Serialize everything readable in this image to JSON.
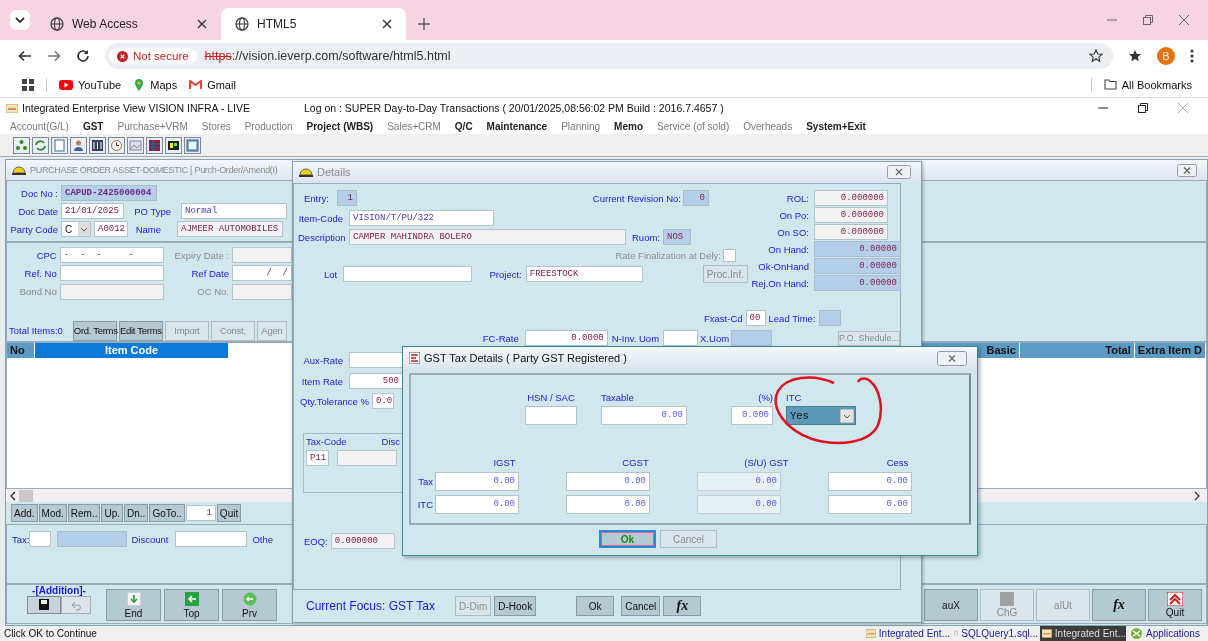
{
  "browser": {
    "tabs": [
      {
        "label": "Web Access",
        "selected": false
      },
      {
        "label": "HTML5",
        "selected": true
      }
    ],
    "security": "Not secure",
    "url_scheme": "https",
    "url_rest": "://vision.ieverp.com/software/html5.html",
    "profile": "B",
    "bookmarks": [
      "YouTube",
      "Maps",
      "Gmail"
    ],
    "all_bookmarks": "All Bookmarks"
  },
  "app": {
    "title": "Integrated Enterprise View  VISION INFRA - LIVE",
    "logon": "Log on : SUPER  Day-to-Day Transactions ( 20/01/2025,08:56:02 PM Build : 2016.7.4657 )",
    "menu": [
      {
        "label": "Account(G/L)",
        "disabled": true
      },
      {
        "label": "GST",
        "disabled": false
      },
      {
        "label": "Purchase+VRM",
        "disabled": true
      },
      {
        "label": "Stores",
        "disabled": true
      },
      {
        "label": "Production",
        "disabled": true
      },
      {
        "label": "Project (WBS)",
        "disabled": false
      },
      {
        "label": "Sales+CRM",
        "disabled": true
      },
      {
        "label": "Q/C",
        "disabled": false
      },
      {
        "label": "Maintenance",
        "disabled": false
      },
      {
        "label": "Planning",
        "disabled": true
      },
      {
        "label": "Memo",
        "disabled": false
      },
      {
        "label": "Service (of sold)",
        "disabled": true
      },
      {
        "label": "Overheads",
        "disabled": true
      },
      {
        "label": "System+Exit",
        "disabled": false
      }
    ]
  },
  "po_window": {
    "title": "PURCHASE ORDER ASSET-DOMESTIC  [  Purch-Order/Amend(I)",
    "doc_no": {
      "label": "Doc No :",
      "value": "CAPUD-2425000004"
    },
    "doc_date": {
      "label": "Doc Date",
      "value": "21/01/2025"
    },
    "po_type": {
      "label": "PO Type",
      "value": "Normal"
    },
    "party_code": {
      "label": "Party Code",
      "type": "C",
      "value": "A0012"
    },
    "name": {
      "label": "Name",
      "value": "AJMEER AUTOMOBILES"
    },
    "field_rows": [
      [
        {
          "label": "CPC",
          "value": "-  -  -     -",
          "disabled": false
        },
        {
          "label": "Expiry Date :",
          "disabled": true
        }
      ],
      [
        {
          "label": "Ref. No",
          "disabled": false
        },
        {
          "label": "Ref Date",
          "value": " /  /",
          "disabled": false
        }
      ],
      [
        {
          "label": "Bond No",
          "disabled": true
        },
        {
          "label": "OC No.",
          "disabled": true
        }
      ]
    ],
    "total_items": "Total Items:0",
    "terms_buttons": [
      {
        "label": "Ord. Terms",
        "disabled": false
      },
      {
        "label": "Edit Terms",
        "disabled": false
      },
      {
        "label": "Import",
        "disabled": true
      },
      {
        "label": "Const.",
        "disabled": true
      },
      {
        "label": "Agen",
        "disabled": true
      }
    ],
    "columns_left": [
      {
        "label": "No",
        "selected": false
      },
      {
        "label": "Item Code",
        "selected": true
      }
    ],
    "columns_right": [
      "Basic",
      "Total",
      "Extra Item D"
    ],
    "row_buttons": [
      "Add.",
      "Mod.",
      "Rem..",
      "Up.",
      "Dn..",
      "GoTo.."
    ],
    "goto_value": "1",
    "quit": "Quit",
    "tax_label": "Tax:",
    "discount_label": "Discount",
    "other_label": "Othe",
    "mode": "-[Addition]-",
    "nav_left": [
      {
        "label": "End",
        "kind": "down"
      },
      {
        "label": "Top",
        "kind": "left"
      },
      {
        "label": "Prv",
        "kind": "circle"
      }
    ],
    "nav_right": [
      {
        "label": "auX",
        "kind": "text",
        "disabled": false
      },
      {
        "label": "ChG",
        "kind": "square",
        "disabled": true
      },
      {
        "label": "alUt",
        "kind": "text",
        "disabled": true
      },
      {
        "label": "fx",
        "kind": "formula",
        "disabled": false
      },
      {
        "label": "Quit",
        "kind": "quit",
        "disabled": false
      }
    ]
  },
  "details": {
    "title": "Details",
    "entry": {
      "label": "Entry:",
      "value": "1"
    },
    "revision": {
      "label": "Current Revision No:",
      "value": "0"
    },
    "stock": [
      {
        "label": "ROL:",
        "value": "0.000000",
        "kind": "input"
      },
      {
        "label": "On Po:",
        "value": "0.000000",
        "kind": "input"
      },
      {
        "label": "On SO:",
        "value": "0.000000",
        "kind": "input"
      },
      {
        "label": "On Hand:",
        "value": "0.00000",
        "kind": "readonly"
      },
      {
        "label": "Ok-OnHand",
        "value": "0.00000",
        "kind": "readonly"
      },
      {
        "label": "Rej.On Hand:",
        "value": "0.00000",
        "kind": "readonly"
      }
    ],
    "item_code": {
      "label": "Item-Code",
      "value": "VISION/T/PU/322"
    },
    "description": {
      "label": "Description",
      "value": "CAMPER MAHINDRA BOLERO"
    },
    "ruom": {
      "label": "Ruom:",
      "value": "NOS"
    },
    "rate_final": {
      "label": "Rate Finalization at Dely:",
      "checked": false
    },
    "lot": {
      "label": "Lot"
    },
    "project": {
      "label": "Project:",
      "value": "FREESTOCK"
    },
    "proc_inf": "Proc.Inf.",
    "fxast": {
      "label": "Fxast-Cd",
      "value": "00"
    },
    "lead_time": {
      "label": "Lead Time:"
    },
    "fc_rate": {
      "label": "FC-Rate",
      "value": "0.0000"
    },
    "n_inv_uom": {
      "label": "N-Inv. Uom"
    },
    "x_uom": {
      "label": "X.Uom"
    },
    "po_schedule": "P.O. Shedule...",
    "aux_rate": {
      "label": "Aux-Rate"
    },
    "item_rate": {
      "label": "Item Rate",
      "value": "500"
    },
    "qty_tol": {
      "label": "Qty.Tolerance %",
      "value": "0.0"
    },
    "tax_code": {
      "label": "Tax-Code",
      "value": "P11"
    },
    "disc_label": "Disc",
    "eoq": {
      "label": "EOQ:",
      "value": "0.000000"
    },
    "focus": "Current Focus: GST Tax",
    "buttons": [
      {
        "label": "D-Dim",
        "disabled": true
      },
      {
        "label": "D-Hook",
        "disabled": false
      },
      {
        "label": "Ok",
        "disabled": false
      },
      {
        "label": "Cancel",
        "disabled": false
      },
      {
        "label": "fx",
        "disabled": false
      }
    ]
  },
  "gst": {
    "title": "GST Tax Details  ( Party GST  Registered )",
    "hsn": {
      "label": "HSN / SAC"
    },
    "taxable": {
      "label": "Taxable",
      "value": "0.00"
    },
    "percent": {
      "label": "(%)",
      "value": "0.000"
    },
    "itc": {
      "label": "ITC",
      "value": "Yes"
    },
    "columns": [
      {
        "label": "IGST",
        "disabled": false
      },
      {
        "label": "CGST",
        "disabled": false
      },
      {
        "label": "(S/U) GST",
        "disabled": true
      },
      {
        "label": "Cess",
        "disabled": false
      }
    ],
    "rows": [
      {
        "label": "Tax",
        "values": [
          "0.00",
          "0.00",
          "0.00",
          "0.00"
        ]
      },
      {
        "label": "ITC",
        "values": [
          "0.00",
          "0.00",
          "0.00",
          "0.00"
        ]
      }
    ],
    "buttons": [
      {
        "label": "Ok",
        "disabled": false,
        "focused": true
      },
      {
        "label": "Cancel",
        "disabled": true,
        "focused": false
      }
    ]
  },
  "status": "Click OK to Continue",
  "taskbar": [
    {
      "label": "Integrated Ent...",
      "kind": "app",
      "selected": false
    },
    {
      "label": "SQLQuery1.sql...",
      "kind": "sql",
      "selected": false
    },
    {
      "label": "Integrated Ent...",
      "kind": "app",
      "selected": true
    },
    {
      "label": "Applications",
      "kind": "apps",
      "selected": false
    }
  ]
}
